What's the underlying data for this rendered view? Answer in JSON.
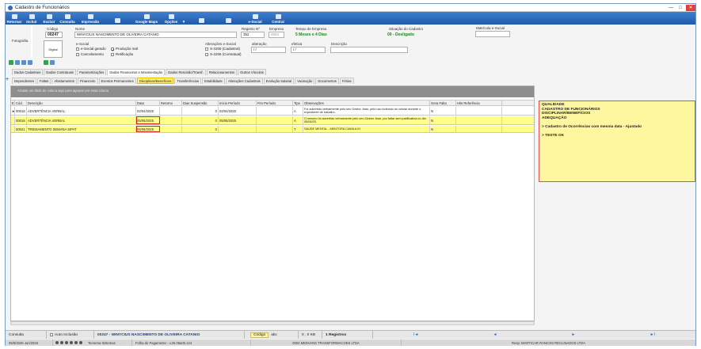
{
  "window": {
    "title": "Cadastro de Funcionários",
    "min": "—",
    "max": "□",
    "close": "✕"
  },
  "toolbar": [
    {
      "label": "Retornar",
      "icon": "back-icon"
    },
    {
      "label": "Incluir",
      "icon": "add-icon"
    },
    {
      "label": "Excluir",
      "icon": "delete-icon"
    },
    {
      "label": "Consulta",
      "icon": "search-icon"
    },
    {
      "label": "Impressão",
      "icon": "print-icon"
    },
    {
      "label": "",
      "icon": "grid-icon"
    },
    {
      "label": "Google Maps",
      "icon": "map-icon"
    },
    {
      "label": "Opções",
      "icon": "options-icon"
    },
    {
      "label": "▼",
      "icon": ""
    },
    {
      "label": "",
      "icon": "check-icon"
    },
    {
      "label": "",
      "icon": "cancel-icon"
    },
    {
      "label": "e-Social",
      "icon": "esocial-icon"
    },
    {
      "label": "Central",
      "icon": "central-icon"
    }
  ],
  "header": {
    "photo_label": "Fotografia",
    "digital_label": "Digital",
    "codigo_label": "Código",
    "codigo": "00247",
    "nome_label": "Nome",
    "nome": "WINYCIUS NASCIMENTO DE OLIVEIRA CATANIO",
    "registro_label": "Registro Nº",
    "registro": "352",
    "empresa_label": "Empresa",
    "empresa": "0004",
    "tempo_label": "Tempo de Empresa",
    "tempo": "5 Meses  e 4 Dias",
    "situacao_label": "Situação do Cadastro",
    "situacao": "09 - Desligado",
    "matricula_label": "Matrícula e-Social",
    "esocial_label": "e-Social",
    "chk_esocial_gerado": "e-Social gerado",
    "chk_producao": "Produção real",
    "chk_cancelamento": "Cancelamento",
    "chk_retificacao": "Retificação",
    "alteracoes_label": "Alterações e-Social",
    "chk_s2205": "S-2205 (Cadastral)",
    "chk_s2206": "S-2206 (Contratual)",
    "alteracao_label": "alteração",
    "alteracao_val": "/ /",
    "efetiva_label": "efetiva",
    "efetiva_val": "/ /",
    "descricao_label": "Descrição"
  },
  "tabs_primary": [
    "Dados Cadastrais",
    "Dados Contratuais",
    "Parametrizações",
    "Dados Financeiros e Movimentação",
    "Dados Rescisão/Transf.",
    "Relacionamentos",
    "Outros Vínculos"
  ],
  "tabs_secondary": [
    "Dependentes",
    "Faltas",
    "Afastamentos",
    "Financeiro",
    "Eventos Permanentes",
    "Disciplinas/Benefícios",
    "Transferências",
    "Estabilidade",
    "Alterações Cadastrais",
    "Evolução Salarial",
    "Vacinação",
    "Documentos",
    "Férias"
  ],
  "grid": {
    "group_hint": "Arraste um título de coluna aqui para agrupar por essa coluna",
    "columns": [
      "E",
      "Cód.",
      "Descrição",
      "Data",
      "Retorno",
      "Dias Suspensão",
      "Início Período",
      "Fim Período",
      "Tipo",
      "Observações",
      "Gera Falta",
      "Hits Referência"
    ],
    "rows": [
      {
        "e": "",
        "cod": "00016",
        "desc": "ADVERTÊNCIA VERBAL",
        "data": "02/04/2025",
        "retorno": "",
        "dias": "0",
        "inicio": "02/04/2025",
        "fim": "",
        "tipo": "A",
        "obs": "Foi advertido verbalmente pelo seu Gestor Jean, pelo uso indevido do celular durante o expediente de trabalho.",
        "falta": "N",
        "hits": ""
      },
      {
        "e": "",
        "cod": "00016",
        "desc": "ADVERTÊNCIA VERBAL",
        "data": "05/06/2025",
        "retorno": "",
        "dias": "0",
        "inicio": "05/06/2025",
        "fim": "",
        "tipo": "A",
        "obs": "O mesmo foi advertido verbalmente pelo seu Gestor Jean, por faltar sem justificativa no dia 05/06/25.",
        "falta": "N",
        "hits": ""
      },
      {
        "e": "",
        "cod": "00021",
        "desc": "TREINAMENTO SEMANA SIPAT",
        "data": "05/06/2025",
        "retorno": "",
        "dias": "0",
        "inicio": "",
        "fim": "",
        "tipo": "T",
        "obs": "SAÚDE MENTAL - MENTORA CAMILA IH",
        "falta": "N",
        "hits": ""
      }
    ]
  },
  "notes": {
    "lines": [
      "QUALIDADE",
      "CADASTRO DE FUNCIONÁRIOS",
      "DISCIPLINAR/BENEFÍCIOS",
      "ADEQUAÇÃO",
      "",
      "> Cadastro de Ocorrências com mesma data - Ajustado",
      "",
      "> TESTE OK"
    ]
  },
  "statusbar": {
    "consulta": "Consulta",
    "auto_inclusao": "Auto Inclusão",
    "employee": "00247 - WINYCIUS NASCIMENTO DE OLIVEIRA CATANIO",
    "codigo": "Código",
    "zoom_label": "abc",
    "zoom": "0 , 0",
    "kb": "KB",
    "registros": "1 Registros",
    "nav_first": "I◄",
    "nav_prev": "◄",
    "nav_next": "►",
    "nav_last": "►I"
  },
  "footer": {
    "date": "05/6/2025 Jun/2026",
    "sistema": "Teorema Sistemas",
    "folha": "Folha de Pagamento - v.26.06a06.124",
    "empresa": "0004 MEDVANS TRANSFORMACOES LTDA",
    "resp": "Resp: MARTICAR RANCOS RECLINADOS LTDA"
  },
  "colors": {
    "toolbar": "#2f6db5",
    "highlight": "#ffff88",
    "note_bg": "#fff7a0",
    "note_border": "#e05050",
    "status_green": "#1a8a1a"
  }
}
